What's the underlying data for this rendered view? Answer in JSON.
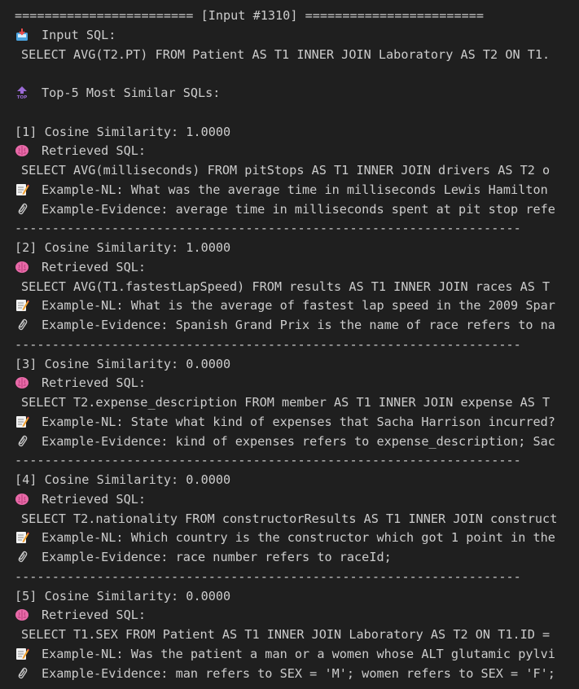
{
  "header_line": "======================== [Input #1310] ========================",
  "input_label": "Input SQL:",
  "input_sql": "SELECT AVG(T2.PT) FROM Patient AS T1 INNER JOIN Laboratory AS T2 ON T1.",
  "top_label": "Top-5 Most Similar SQLs:",
  "retrieved_label": "Retrieved SQL:",
  "separator": "--------------------------------------------------------------------",
  "icons": {
    "input": "inbox-tray-icon",
    "top": "top-arrow-icon",
    "retrieved": "brain-icon",
    "nl": "memo-icon",
    "evidence": "paperclip-icon"
  },
  "colors": {
    "background": "#1f1f1f",
    "text": "#cccccc",
    "brain": "#e86aa8",
    "top": "#9b6bd6",
    "inbox": "#4aa3df"
  },
  "results": [
    {
      "similarity": "[1] Cosine Similarity: 1.0000",
      "sql": "SELECT AVG(milliseconds) FROM pitStops AS T1 INNER JOIN drivers AS T2 o",
      "nl": "Example-NL: What was the average time in milliseconds Lewis Hamilton",
      "evidence": "Example-Evidence: average time in milliseconds spent at pit stop refe"
    },
    {
      "similarity": "[2] Cosine Similarity: 1.0000",
      "sql": "SELECT AVG(T1.fastestLapSpeed) FROM results AS T1 INNER JOIN races AS T",
      "nl": "Example-NL: What is the average of fastest lap speed in the 2009 Spar",
      "evidence": "Example-Evidence: Spanish Grand Prix is the name of race refers to na"
    },
    {
      "similarity": "[3] Cosine Similarity: 0.0000",
      "sql": "SELECT T2.expense_description FROM member AS T1 INNER JOIN expense AS T",
      "nl": "Example-NL: State what kind of expenses that Sacha Harrison incurred?",
      "evidence": "Example-Evidence: kind of expenses refers to expense_description; Sac"
    },
    {
      "similarity": "[4] Cosine Similarity: 0.0000",
      "sql": "SELECT T2.nationality FROM constructorResults AS T1 INNER JOIN construct",
      "nl": "Example-NL: Which country is the constructor which got 1 point in the",
      "evidence": "Example-Evidence: race number refers to raceId;"
    },
    {
      "similarity": "[5] Cosine Similarity: 0.0000",
      "sql": "SELECT T1.SEX FROM Patient AS T1 INNER JOIN Laboratory AS T2 ON T1.ID =",
      "nl": "Example-NL: Was the patient a man or a women whose ALT glutamic pylvi",
      "evidence": "Example-Evidence: man refers to SEX = 'M'; women refers to SEX = 'F';"
    }
  ]
}
